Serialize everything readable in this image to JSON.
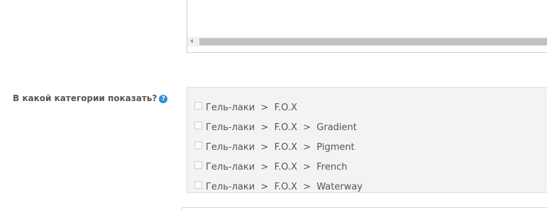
{
  "form": {
    "category_field": {
      "label": "В какой категории показать?",
      "help_icon": "question-circle-icon",
      "help_glyph": "?",
      "options": [
        {
          "label": "Гель-лаки  >  F.O.X",
          "checked": false
        },
        {
          "label": "Гель-лаки  >  F.O.X  >  Gradient",
          "checked": false
        },
        {
          "label": "Гель-лаки  >  F.O.X  >  Pigment",
          "checked": false
        },
        {
          "label": "Гель-лаки  >  F.O.X  >  French",
          "checked": false
        },
        {
          "label": "Гель-лаки  >  F.O.X  >  Waterway",
          "checked": false
        }
      ]
    }
  },
  "colors": {
    "help_icon": "#2b8fd9",
    "label_text": "#555555",
    "list_background": "#f3f3f3"
  }
}
